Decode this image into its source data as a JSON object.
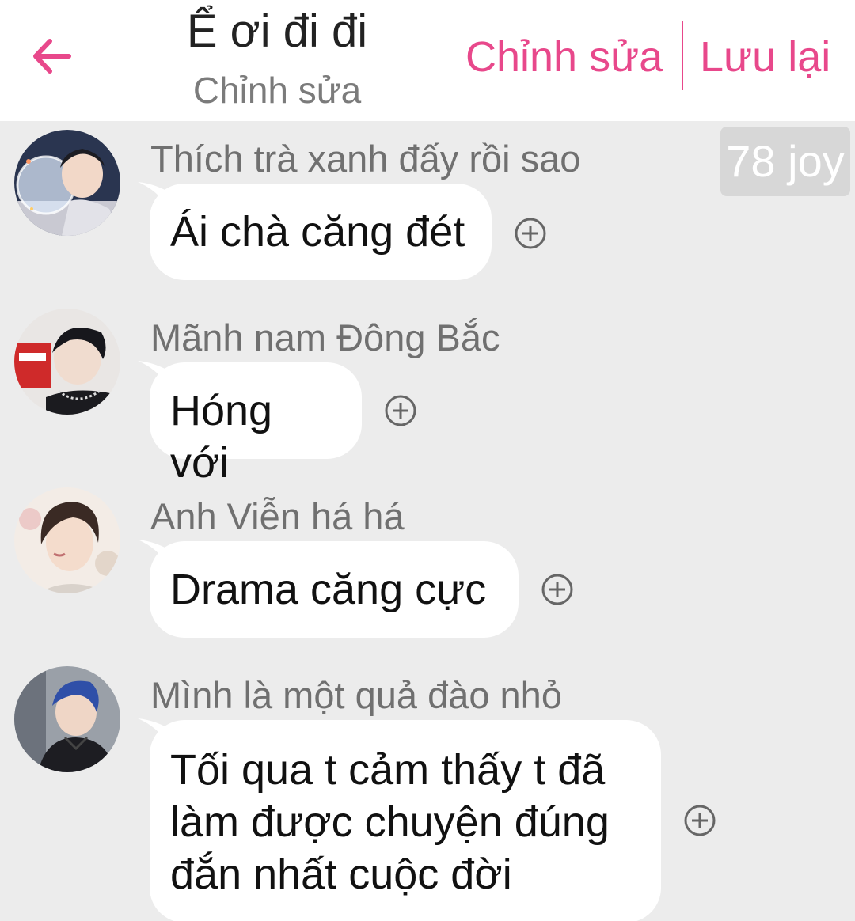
{
  "header": {
    "title": "Ể ơi đi đi",
    "subtitle": "Chỉnh sửa",
    "edit_label": "Chỉnh sửa",
    "save_label": "Lưu lại",
    "accent_color": "#e8488b"
  },
  "joy_badge": "78 joy",
  "messages": [
    {
      "sender": "Thích trà xanh đấy rồi sao",
      "text": "Ái chà căng đét",
      "avatar": "avatar-boy-balloon"
    },
    {
      "sender": "Mãnh nam Đông Bắc",
      "text": "Hóng với",
      "avatar": "avatar-boy-phone"
    },
    {
      "sender": "Anh Viễn há há",
      "text": "Drama căng cực",
      "avatar": "avatar-boy-portrait"
    },
    {
      "sender": "Mình là một quả đào nhỏ",
      "text": "Tối qua t cảm thấy t đã làm được chuyện đúng đắn nhất cuộc đời",
      "avatar": "avatar-boy-blue-hair"
    }
  ],
  "icons": {
    "back": "arrow-left-icon",
    "add": "plus-circle-icon"
  }
}
